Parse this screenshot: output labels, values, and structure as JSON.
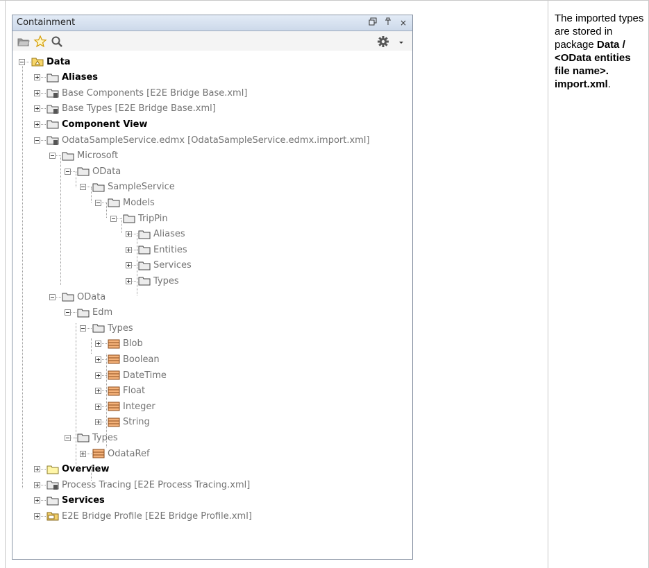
{
  "panel": {
    "title": "Containment",
    "buttons": {
      "restore": "⧉",
      "pin": "⚲",
      "close": "×"
    },
    "tools": [
      "folder-icon",
      "star-icon",
      "search-icon",
      "gear-icon",
      "dropdown-icon"
    ]
  },
  "tree": [
    {
      "label": "Data",
      "style": "bold",
      "icon": "package-data-icon",
      "expander": "minus"
    },
    {
      "label": "Aliases",
      "style": "bold",
      "icon": "folder-icon",
      "expander": "plus"
    },
    {
      "label": "Base Components [E2E Bridge Base.xml]",
      "style": "gray",
      "icon": "folder-shared-icon",
      "expander": "plus"
    },
    {
      "label": "Base Types [E2E Bridge Base.xml]",
      "style": "gray",
      "icon": "folder-shared-icon",
      "expander": "plus"
    },
    {
      "label": "Component View",
      "style": "bold",
      "icon": "folder-icon",
      "expander": "plus"
    },
    {
      "label": "OdataSampleService.edmx [OdataSampleService.edmx.import.xml]",
      "style": "gray",
      "icon": "folder-shared-icon",
      "expander": "minus"
    },
    {
      "label": "Microsoft",
      "style": "gray",
      "icon": "folder-icon",
      "expander": "minus"
    },
    {
      "label": "OData",
      "style": "gray",
      "icon": "folder-icon",
      "expander": "minus"
    },
    {
      "label": "SampleService",
      "style": "gray",
      "icon": "folder-icon",
      "expander": "minus"
    },
    {
      "label": "Models",
      "style": "gray",
      "icon": "folder-icon",
      "expander": "minus"
    },
    {
      "label": "TripPin",
      "style": "gray",
      "icon": "folder-icon",
      "expander": "minus"
    },
    {
      "label": "Aliases",
      "style": "gray",
      "icon": "folder-icon",
      "expander": "plus"
    },
    {
      "label": "Entities",
      "style": "gray",
      "icon": "folder-icon",
      "expander": "plus"
    },
    {
      "label": "Services",
      "style": "gray",
      "icon": "folder-icon",
      "expander": "plus"
    },
    {
      "label": "Types",
      "style": "gray",
      "icon": "folder-icon",
      "expander": "plus"
    },
    {
      "label": "OData",
      "style": "gray",
      "icon": "folder-icon",
      "expander": "minus"
    },
    {
      "label": "Edm",
      "style": "gray",
      "icon": "folder-icon",
      "expander": "minus"
    },
    {
      "label": "Types",
      "style": "gray",
      "icon": "folder-icon",
      "expander": "minus"
    },
    {
      "label": "Blob",
      "style": "gray",
      "icon": "class-icon",
      "expander": "plus"
    },
    {
      "label": "Boolean",
      "style": "gray",
      "icon": "class-icon",
      "expander": "plus"
    },
    {
      "label": "DateTime",
      "style": "gray",
      "icon": "class-icon",
      "expander": "plus"
    },
    {
      "label": "Float",
      "style": "gray",
      "icon": "class-icon",
      "expander": "plus"
    },
    {
      "label": "Integer",
      "style": "gray",
      "icon": "class-icon",
      "expander": "plus"
    },
    {
      "label": "String",
      "style": "gray",
      "icon": "class-icon",
      "expander": "plus"
    },
    {
      "label": "Types",
      "style": "gray",
      "icon": "folder-icon",
      "expander": "minus"
    },
    {
      "label": "OdataRef",
      "style": "gray",
      "icon": "class-icon",
      "expander": "plus"
    },
    {
      "label": "Overview",
      "style": "bold",
      "icon": "folder-yellow-icon",
      "expander": "plus"
    },
    {
      "label": "Process Tracing [E2E Process Tracing.xml]",
      "style": "gray",
      "icon": "folder-shared-icon",
      "expander": "plus"
    },
    {
      "label": "Services",
      "style": "bold",
      "icon": "folder-icon",
      "expander": "plus"
    },
    {
      "label": "E2E Bridge Profile [E2E Bridge Profile.xml]",
      "style": "gray",
      "icon": "profile-icon",
      "expander": "plus"
    }
  ],
  "note": {
    "intro": "The imported types are stored in package ",
    "bold_text": "Data / <OData entities file name>. import.xml",
    "end": "."
  },
  "colors": {
    "titlebar": "#cdd9ea",
    "class_icon": "#f0a868",
    "folder": "#555555"
  }
}
